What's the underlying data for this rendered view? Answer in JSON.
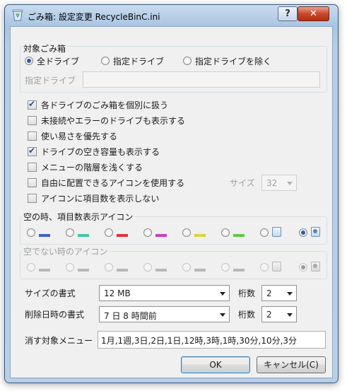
{
  "window": {
    "title": "ごみ箱: 設定変更  RecycleBinC.ini",
    "help_label": "?",
    "close_label": "✕"
  },
  "target": {
    "group_label": "対象ごみ箱",
    "options": [
      "全ドライブ",
      "指定ドライブ",
      "指定ドライブを除く"
    ],
    "selected_index": 0,
    "drive_label": "指定ドライブ",
    "drive_value": ""
  },
  "options": {
    "items": [
      {
        "label": "各ドライブのごみ箱を個別に扱う",
        "checked": true
      },
      {
        "label": "未接続やエラーのドライブも表示する",
        "checked": false
      },
      {
        "label": "使い易さを優先する",
        "checked": false
      },
      {
        "label": "ドライブの空き容量も表示する",
        "checked": true
      },
      {
        "label": "メニューの階層を浅くする",
        "checked": false
      },
      {
        "label": "自由に配置できるアイコンを使用する",
        "checked": false
      },
      {
        "label": "アイコンに項目数を表示しない",
        "checked": false
      }
    ],
    "size_label": "サイズ",
    "size_value": "32"
  },
  "empty_icons": {
    "label": "空の時、項目数表示アイコン",
    "bar_colors": [
      "#3d62c9",
      "#3fc7a6",
      "#e0323a",
      "#c33fc5",
      "#d8d43a",
      "#5fc940"
    ],
    "selected_index": 7
  },
  "nonempty_icons": {
    "label": "空でない時のアイコン",
    "selected_index": 7
  },
  "format": {
    "size_label": "サイズの書式",
    "size_value": "12 MB",
    "date_label": "削除日時の書式",
    "date_value": "7 日 8 時間前",
    "digits_label": "桁数",
    "size_digits": "2",
    "date_digits": "2"
  },
  "purge": {
    "label": "消す対象メニュー",
    "value": "1月,1週,3日,2日,1日,12時,3時,1時,30分,10分,3分"
  },
  "buttons": {
    "ok": "OK",
    "cancel": "キャンセル(C)"
  }
}
